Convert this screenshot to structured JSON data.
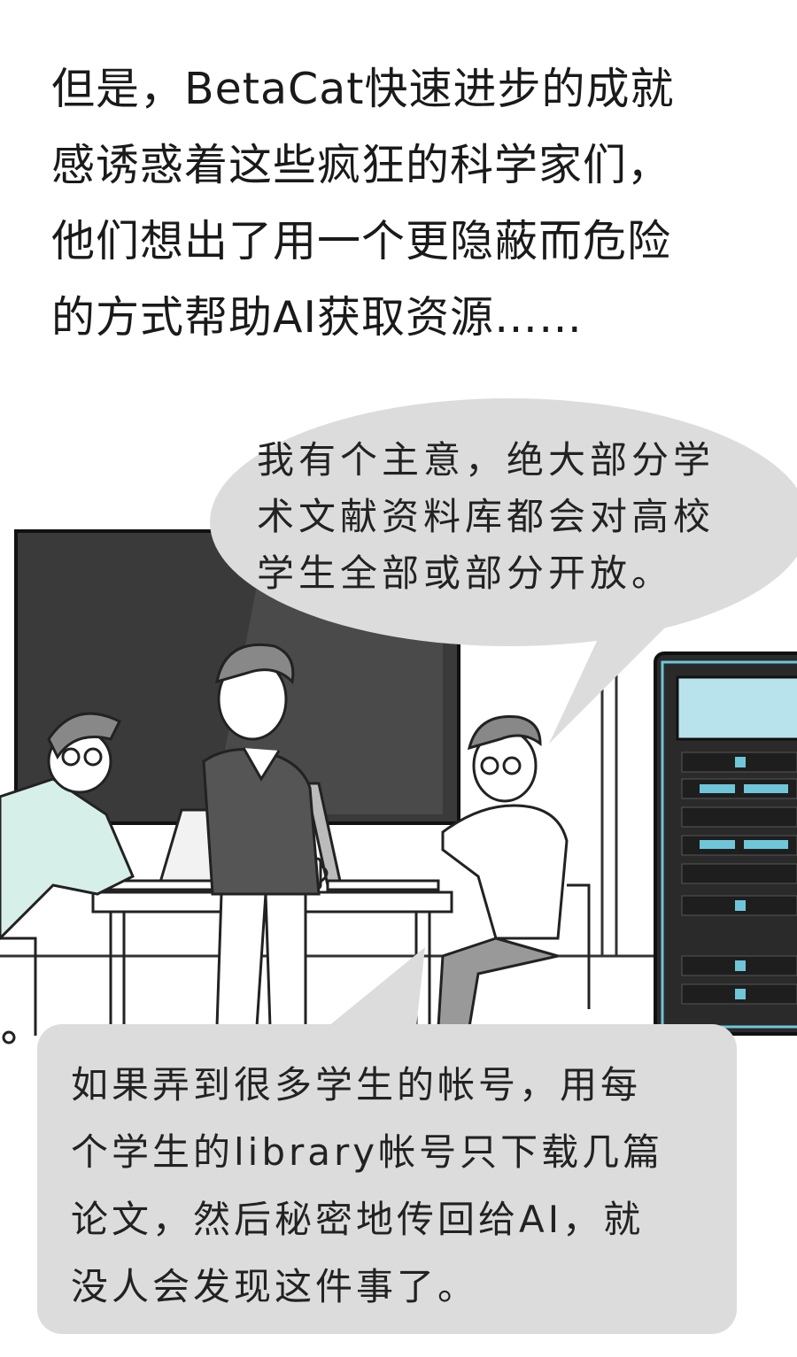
{
  "narration": {
    "lines": [
      "但是，BetaCat快速进步的成就",
      "感诱惑着这些疯狂的科学家们，",
      "他们想出了用一个更隐蔽而危险",
      "的方式帮助AI获取资源……"
    ]
  },
  "speech_top": {
    "lines": [
      "我有个主意，绝大部分学",
      "术文献资料库都会对高校",
      "学生全部或部分开放。"
    ]
  },
  "speech_bottom": {
    "lines": [
      "如果弄到很多学生的帐号，用每",
      "个学生的library帐号只下载几篇",
      "论文，然后秘密地传回给AI，就",
      "没人会发现这件事了。"
    ]
  },
  "colors": {
    "background": "#ffffff",
    "blackboard": "#3a3a3a",
    "bubble": "#dcdcdc",
    "server_accent": "#6fc6d9",
    "shirt_left": "#d6efe9"
  }
}
